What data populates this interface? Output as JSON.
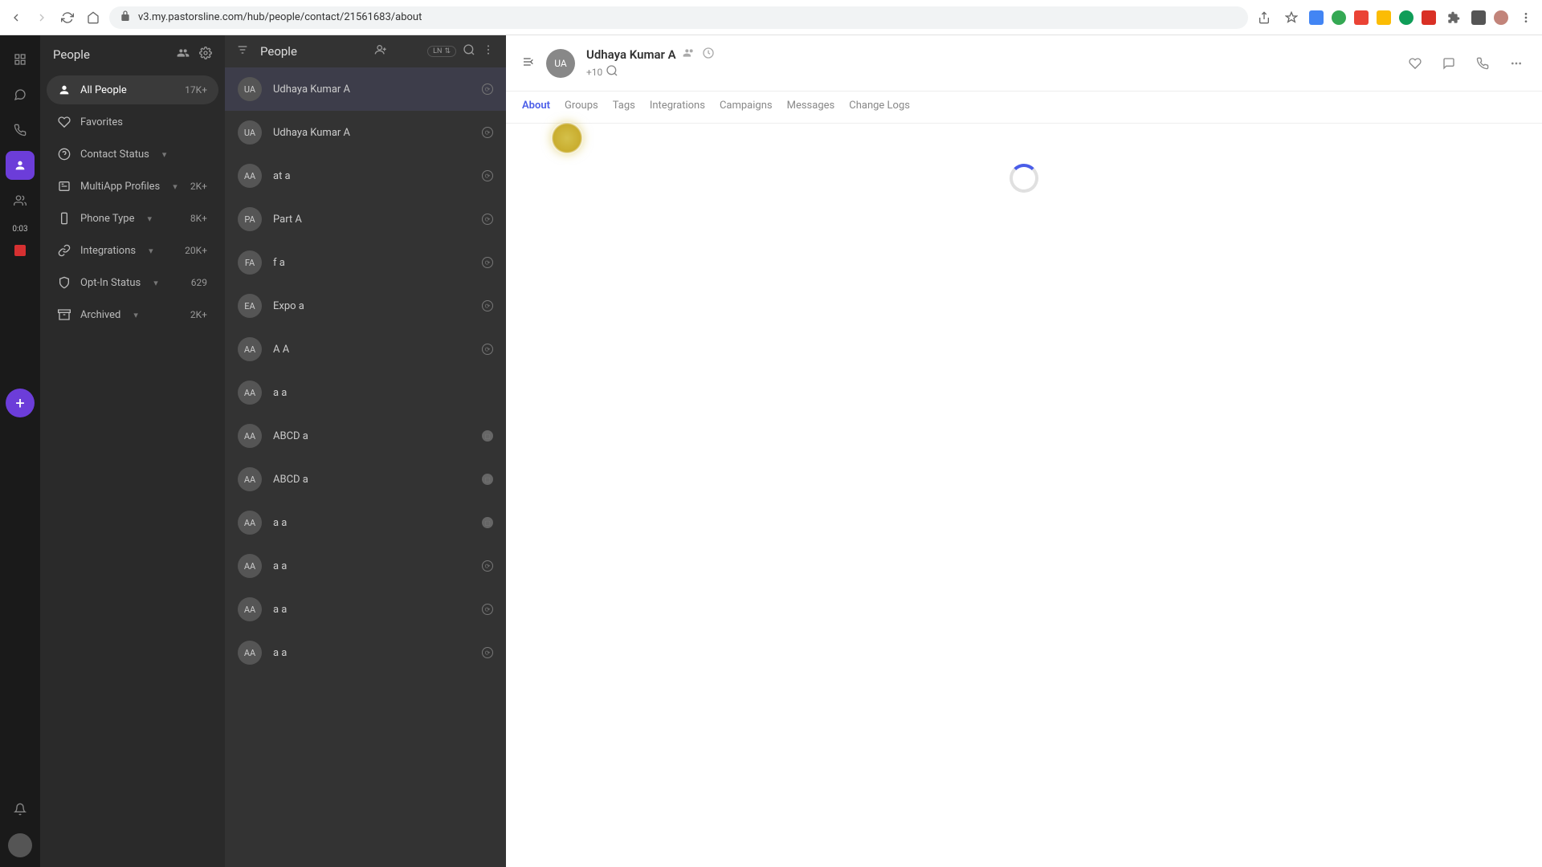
{
  "browser": {
    "url": "v3.my.pastorsline.com/hub/people/contact/21561683/about"
  },
  "rail": {
    "time": "0:03"
  },
  "sidebar": {
    "title": "People",
    "items": [
      {
        "label": "All People",
        "count": "17K+"
      },
      {
        "label": "Favorites",
        "count": ""
      },
      {
        "label": "Contact Status",
        "count": ""
      },
      {
        "label": "MultiApp Profiles",
        "count": "2K+"
      },
      {
        "label": "Phone Type",
        "count": "8K+"
      },
      {
        "label": "Integrations",
        "count": "20K+"
      },
      {
        "label": "Opt-In Status",
        "count": "629"
      },
      {
        "label": "Archived",
        "count": "2K+"
      }
    ]
  },
  "list": {
    "title": "People",
    "pill": "LN",
    "contacts": [
      {
        "initials": "UA",
        "name": "Udhaya Kumar A",
        "badge": "sync"
      },
      {
        "initials": "UA",
        "name": "Udhaya Kumar A",
        "badge": "sync"
      },
      {
        "initials": "AA",
        "name": "at a",
        "badge": "sync"
      },
      {
        "initials": "PA",
        "name": "Part A",
        "badge": "sync"
      },
      {
        "initials": "FA",
        "name": "f a",
        "badge": "sync"
      },
      {
        "initials": "EA",
        "name": "Expo a",
        "badge": "sync"
      },
      {
        "initials": "AA",
        "name": "A A",
        "badge": "sync"
      },
      {
        "initials": "AA",
        "name": "a a",
        "badge": ""
      },
      {
        "initials": "AA",
        "name": "ABCD a",
        "badge": "box"
      },
      {
        "initials": "AA",
        "name": "ABCD a",
        "badge": "box"
      },
      {
        "initials": "AA",
        "name": "a a",
        "badge": "box"
      },
      {
        "initials": "AA",
        "name": "a a",
        "badge": "sync"
      },
      {
        "initials": "AA",
        "name": "a a",
        "badge": "sync"
      },
      {
        "initials": "AA",
        "name": "a a",
        "badge": "sync"
      }
    ]
  },
  "detail": {
    "initials": "UA",
    "name": "Udhaya Kumar A",
    "phone": "+10",
    "tabs": [
      "About",
      "Groups",
      "Tags",
      "Integrations",
      "Campaigns",
      "Messages",
      "Change Logs"
    ]
  }
}
